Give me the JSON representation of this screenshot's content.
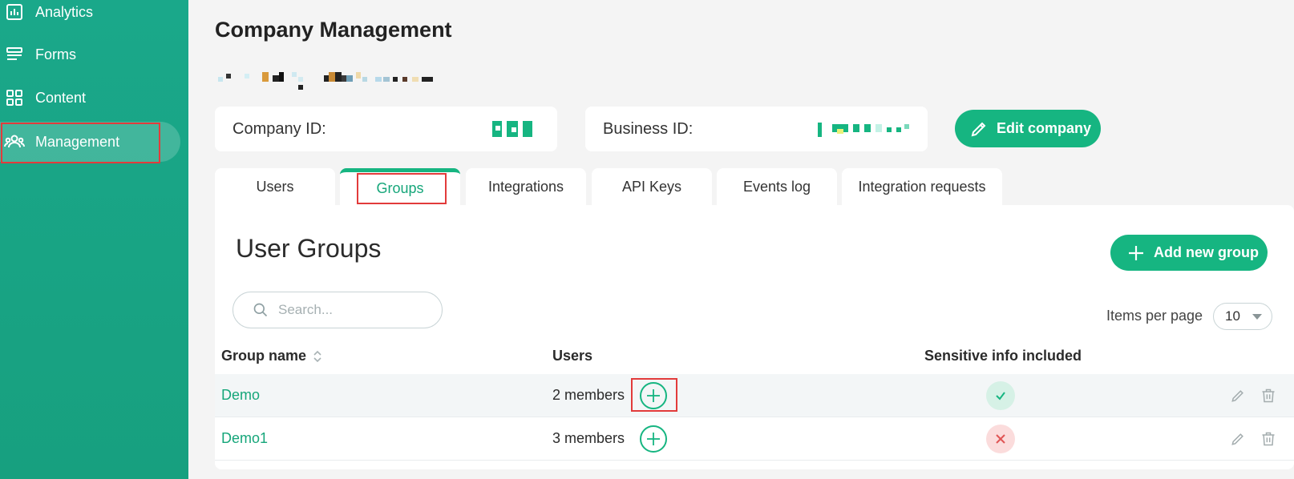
{
  "sidebar": {
    "items": [
      {
        "label": "Analytics",
        "icon": "chart-icon"
      },
      {
        "label": "Forms",
        "icon": "forms-icon"
      },
      {
        "label": "Content",
        "icon": "grid-icon"
      },
      {
        "label": "Management",
        "icon": "users-icon",
        "active": true
      }
    ]
  },
  "header": {
    "title": "Company Management",
    "company_id_label": "Company ID:",
    "business_id_label": "Business ID:",
    "edit_button": "Edit company"
  },
  "tabs": [
    {
      "label": "Users"
    },
    {
      "label": "Groups",
      "active": true
    },
    {
      "label": "Integrations"
    },
    {
      "label": "API Keys"
    },
    {
      "label": "Events log"
    },
    {
      "label": "Integration requests"
    }
  ],
  "panel": {
    "title": "User Groups",
    "add_button": "Add new group",
    "search_placeholder": "Search...",
    "items_per_page_label": "Items per page",
    "items_per_page_value": "10"
  },
  "table": {
    "columns": [
      "Group name",
      "Users",
      "Sensitive info included"
    ],
    "rows": [
      {
        "name": "Demo",
        "users": "2 members",
        "sensitive": true
      },
      {
        "name": "Demo1",
        "users": "3 members",
        "sensitive": false
      }
    ]
  },
  "colors": {
    "accent": "#16b581",
    "sidebar": "#1aa88a",
    "annotation": "#e23b3b",
    "error": "#e05555"
  }
}
